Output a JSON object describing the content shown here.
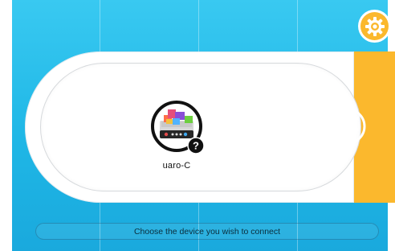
{
  "device": {
    "label": "uaro-C",
    "icon": "robot-kit-icon",
    "status_icon": "question-mark-icon"
  },
  "buttons": {
    "settings_icon": "gear-icon",
    "refresh_icon": "refresh-icon"
  },
  "status": {
    "message": "Choose the device you wish to connect"
  },
  "colors": {
    "background": "#1fb7e6",
    "accent": "#fbb82d",
    "panel": "#ffffff"
  }
}
